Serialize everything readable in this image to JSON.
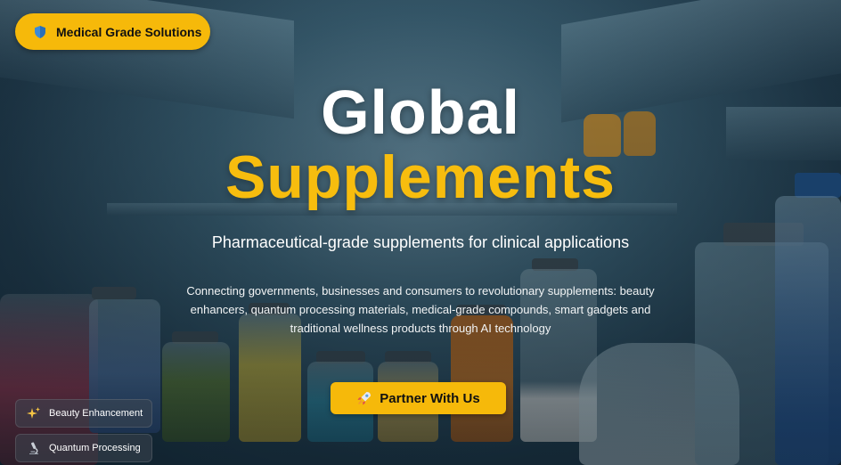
{
  "badge": {
    "label": "Medical Grade Solutions",
    "icon": "shield-icon"
  },
  "hero": {
    "title_line1": "Global",
    "title_line2": "Supplements",
    "subtitle": "Pharmaceutical-grade supplements for clinical applications",
    "description": "Connecting governments, businesses and consumers to revolutionary supplements: beauty enhancers, quantum processing materials, medical-grade compounds, smart gadgets and traditional wellness products through AI technology"
  },
  "cta": {
    "label": "Partner With Us",
    "icon": "rocket-icon"
  },
  "features": [
    {
      "label": "Beauty Enhancement",
      "icon": "sparkles-icon"
    },
    {
      "label": "Quantum Processing",
      "icon": "microscope-icon"
    }
  ],
  "colors": {
    "accent": "#f6b90a",
    "title_white": "#ffffff",
    "title_yellow": "#f7bd0e"
  }
}
